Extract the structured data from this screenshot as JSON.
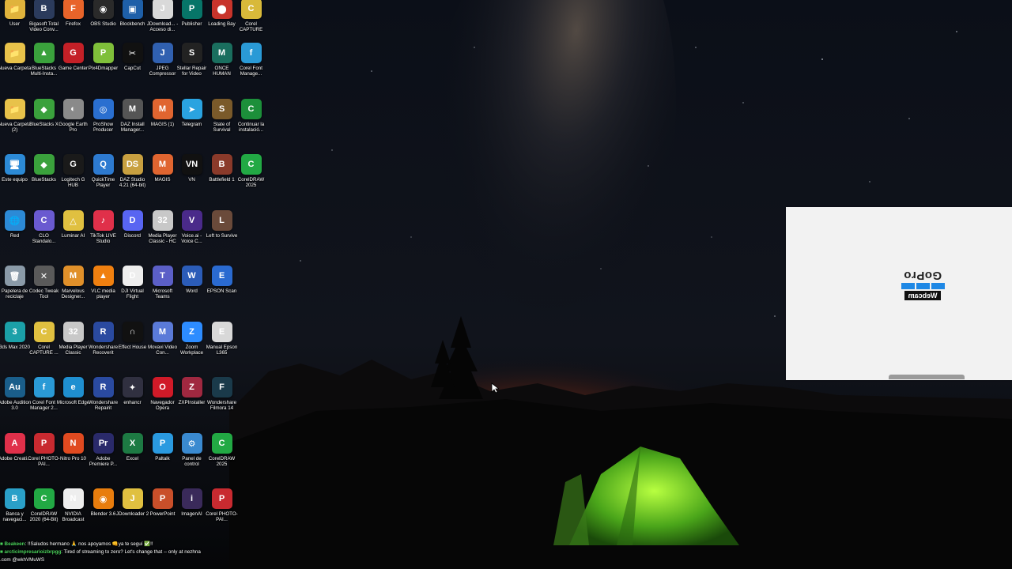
{
  "desktop": {
    "icons": [
      {
        "label": "User",
        "color": "#e0b33c",
        "glyph": "📁"
      },
      {
        "label": "Bigasoft Total Video Conv...",
        "color": "#2b3b5c",
        "glyph": "B"
      },
      {
        "label": "Firefox",
        "color": "#e8642a",
        "glyph": "F"
      },
      {
        "label": "OBS Studio",
        "color": "#2a2a2a",
        "glyph": "◉"
      },
      {
        "label": "Blockbench",
        "color": "#1e5fa8",
        "glyph": "▣"
      },
      {
        "label": "JDownload... - Acceso di...",
        "color": "#d9d9d9",
        "glyph": "J"
      },
      {
        "label": "Publisher",
        "color": "#077568",
        "glyph": "P"
      },
      {
        "label": "Loading Bay",
        "color": "#c8342b",
        "glyph": "⬤"
      },
      {
        "label": "Corel CAPTURE",
        "color": "#d8b93a",
        "glyph": "C"
      },
      {
        "label": "Nueva Carpeta",
        "color": "#e8c24a",
        "glyph": "📁"
      },
      {
        "label": "BlueStacks Multi-Insta...",
        "color": "#3aa13c",
        "glyph": "▲"
      },
      {
        "label": "Game Center",
        "color": "#c42027",
        "glyph": "G"
      },
      {
        "label": "Pix4Dmapper",
        "color": "#7fbf3a",
        "glyph": "P"
      },
      {
        "label": "CapCut",
        "color": "#111111",
        "glyph": "✂"
      },
      {
        "label": "JPEG Compressor",
        "color": "#3060b0",
        "glyph": "J"
      },
      {
        "label": "Stellar Repair for Video",
        "color": "#222222",
        "glyph": "S"
      },
      {
        "label": "ONCE HUMAN",
        "color": "#1a6e5e",
        "glyph": "M"
      },
      {
        "label": "Corel Font Manage...",
        "color": "#2a9ad6",
        "glyph": "f"
      },
      {
        "label": "Nueva Carpeta (2)",
        "color": "#e8c24a",
        "glyph": "📁"
      },
      {
        "label": "BlueStacks X",
        "color": "#3aa13c",
        "glyph": "◆"
      },
      {
        "label": "Google Earth Pro",
        "color": "#8a8a8a",
        "glyph": "◐"
      },
      {
        "label": "ProShow Producer",
        "color": "#2a6fd0",
        "glyph": "◎"
      },
      {
        "label": "DAZ Install Manager...",
        "color": "#555555",
        "glyph": "M"
      },
      {
        "label": "MAGIS (1)",
        "color": "#e06530",
        "glyph": "M"
      },
      {
        "label": "Telegram",
        "color": "#2aa3e0",
        "glyph": "➤"
      },
      {
        "label": "State of Survival",
        "color": "#7a5a2a",
        "glyph": "S"
      },
      {
        "label": "Continuar la instalació...",
        "color": "#1c8f3a",
        "glyph": "C"
      },
      {
        "label": "Este equipo",
        "color": "#2c8ad6",
        "glyph": "🖥"
      },
      {
        "label": "BlueStacks",
        "color": "#3aa13c",
        "glyph": "◆"
      },
      {
        "label": "Logitech G HUB",
        "color": "#1a1a1a",
        "glyph": "G"
      },
      {
        "label": "QuickTime Player",
        "color": "#2d7ad0",
        "glyph": "Q"
      },
      {
        "label": "DAZ Studio 4.21 (64-bit)",
        "color": "#c8a040",
        "glyph": "DS"
      },
      {
        "label": "MAGIS",
        "color": "#e06530",
        "glyph": "M"
      },
      {
        "label": "VN",
        "color": "#111111",
        "glyph": "VN"
      },
      {
        "label": "Battlefield 1",
        "color": "#8a3a2a",
        "glyph": "B"
      },
      {
        "label": "CorelDRAW 2025",
        "color": "#22a944",
        "glyph": "C"
      },
      {
        "label": "Red",
        "color": "#2c8ad6",
        "glyph": "🌐"
      },
      {
        "label": "CLO Standalo...",
        "color": "#6a5ad0",
        "glyph": "C"
      },
      {
        "label": "Luminar AI",
        "color": "#e0c040",
        "glyph": "△"
      },
      {
        "label": "TikTok LIVE Studio",
        "color": "#e0304a",
        "glyph": "♪"
      },
      {
        "label": "Discord",
        "color": "#5865f2",
        "glyph": "D"
      },
      {
        "label": "Media Player Classic - HC",
        "color": "#c8c8c8",
        "glyph": "32"
      },
      {
        "label": "Voice.ai - Voice C...",
        "color": "#4a2a8a",
        "glyph": "V"
      },
      {
        "label": "Left to Survive",
        "color": "#6a4a3a",
        "glyph": "L"
      },
      {
        "label": "Papelera de reciclaje",
        "color": "#8a9aa8",
        "glyph": "🗑"
      },
      {
        "label": "Codec Tweak Tool",
        "color": "#5a5a5a",
        "glyph": "✕"
      },
      {
        "label": "Marvelous Designer...",
        "color": "#e0902a",
        "glyph": "M"
      },
      {
        "label": "VLC media player",
        "color": "#f08010",
        "glyph": "▲"
      },
      {
        "label": "DJI Virtual Flight",
        "color": "#eeeeee",
        "glyph": "D"
      },
      {
        "label": "Microsoft Teams",
        "color": "#5b5fc7",
        "glyph": "T"
      },
      {
        "label": "Word",
        "color": "#2b5cb8",
        "glyph": "W"
      },
      {
        "label": "EPSON Scan",
        "color": "#2a6ad0",
        "glyph": "E"
      },
      {
        "label": "3ds Max 2020",
        "color": "#1ba0a8",
        "glyph": "3"
      },
      {
        "label": "Corel CAPTURE ...",
        "color": "#e0c040",
        "glyph": "C"
      },
      {
        "label": "Media Player Classic",
        "color": "#c8c8c8",
        "glyph": "32"
      },
      {
        "label": "Wondershare Recoverit",
        "color": "#2a4aa0",
        "glyph": "R"
      },
      {
        "label": "Effect House",
        "color": "#111111",
        "glyph": "∩"
      },
      {
        "label": "Movavi Video Con...",
        "color": "#5a7ad8",
        "glyph": "M"
      },
      {
        "label": "Zoom Workplace",
        "color": "#2d8cff",
        "glyph": "Z"
      },
      {
        "label": "Manual Epson L365",
        "color": "#d8d8d8",
        "glyph": "E"
      },
      {
        "label": "Adobe Audition 3.0",
        "color": "#1a5e8a",
        "glyph": "Au"
      },
      {
        "label": "Corel Font Manager 2...",
        "color": "#2a9ad6",
        "glyph": "f"
      },
      {
        "label": "Microsoft Edge",
        "color": "#1f8fd0",
        "glyph": "e"
      },
      {
        "label": "Wondershare Repairit",
        "color": "#2a4aa0",
        "glyph": "R"
      },
      {
        "label": "enhancr",
        "color": "#303040",
        "glyph": "✦"
      },
      {
        "label": "Navegador Opera",
        "color": "#d01a28",
        "glyph": "O"
      },
      {
        "label": "ZXPInstaller",
        "color": "#a02840",
        "glyph": "Z"
      },
      {
        "label": "Wondershare Filmora 14",
        "color": "#1a3a4a",
        "glyph": "F"
      },
      {
        "label": "Adobe Creati...",
        "color": "#e0304a",
        "glyph": "A"
      },
      {
        "label": "Corel PHOTO-PAI...",
        "color": "#c82a30",
        "glyph": "P"
      },
      {
        "label": "Nitro Pro 10",
        "color": "#e04a20",
        "glyph": "N"
      },
      {
        "label": "Adobe Premiere P...",
        "color": "#2a2a6a",
        "glyph": "Pr"
      },
      {
        "label": "Excel",
        "color": "#1d7a43",
        "glyph": "X"
      },
      {
        "label": "Paltalk",
        "color": "#2a9ae0",
        "glyph": "P"
      },
      {
        "label": "Panel de control",
        "color": "#3a8ad0",
        "glyph": "⚙"
      },
      {
        "label": "CorelDRAW 2025",
        "color": "#22a944",
        "glyph": "C"
      },
      {
        "label": "Banca y navegaci...",
        "color": "#2aa0c8",
        "glyph": "B"
      },
      {
        "label": "CorelDRAW 2020 (64-Bit)",
        "color": "#22a944",
        "glyph": "C"
      },
      {
        "label": "NVIDIA Broadcast",
        "color": "#eeeeee",
        "glyph": "N"
      },
      {
        "label": "Blender 3.6",
        "color": "#e87d0d",
        "glyph": "◉"
      },
      {
        "label": "JDownloader 2",
        "color": "#e0c040",
        "glyph": "J"
      },
      {
        "label": "PowerPoint",
        "color": "#c94f2a",
        "glyph": "P"
      },
      {
        "label": "ImagenAI",
        "color": "#3a2a5a",
        "glyph": "i"
      },
      {
        "label": "Corel PHOTO-PAI...",
        "color": "#c82a30",
        "glyph": "P"
      }
    ]
  },
  "gopro_window": {
    "brand": "GoPro",
    "product": "Webcam",
    "bar_color": "#1e88e5"
  },
  "chat": [
    {
      "user": "Beakeen",
      "message": ": !!Saludos hermano 🙏 nos apoyamos 👊ya te seguí ✅!!"
    },
    {
      "user": "arcticimpresarioizbrpgg",
      "message": ": Tired of streaming to zero? Let's change that -- only at nezhna"
    },
    {
      "user": "",
      "message": ".com @wkhVMuWS"
    }
  ]
}
